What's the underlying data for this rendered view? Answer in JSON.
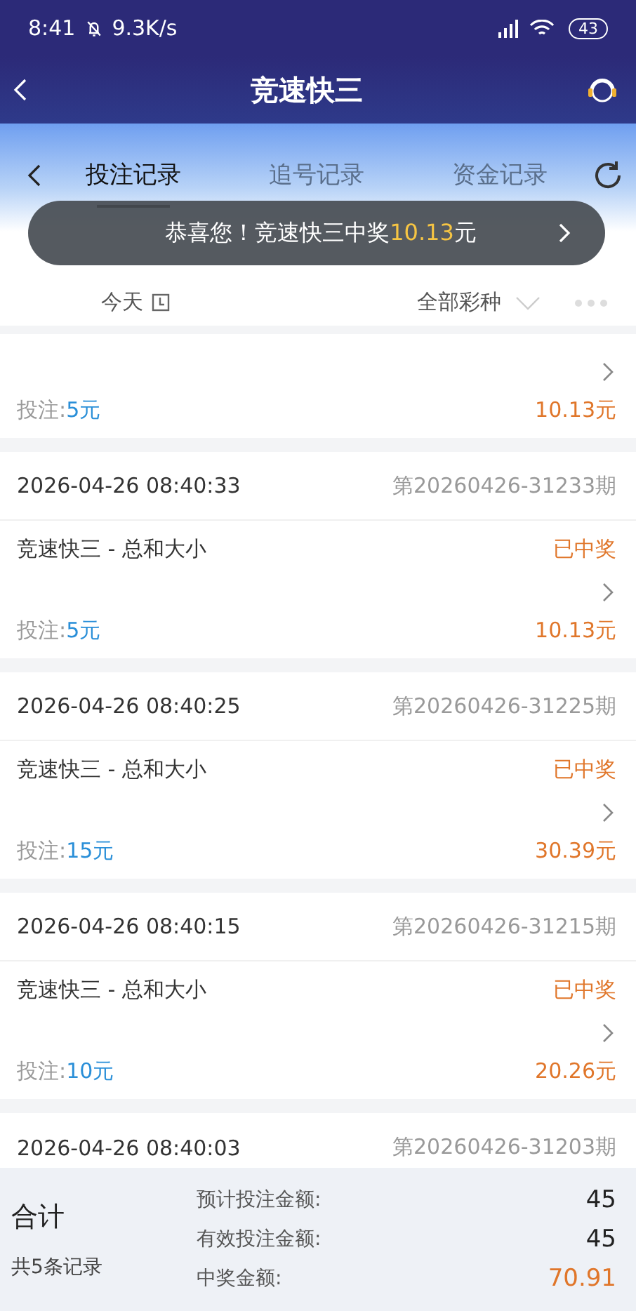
{
  "status_bar": {
    "time": "8:41",
    "speed": "9.3K/s",
    "battery": "43"
  },
  "header": {
    "title": "竞速快三"
  },
  "tabs": [
    {
      "label": "投注记录",
      "selected": true
    },
    {
      "label": "追号记录",
      "selected": false
    },
    {
      "label": "资金记录",
      "selected": false
    }
  ],
  "toast": {
    "message": "恭喜您！竞速快三中奖",
    "amount": "10.13",
    "unit": "元"
  },
  "filter": {
    "date": "今天",
    "lottery": "全部彩种"
  },
  "records": [
    {
      "kind": "partial",
      "bet_label": "投注:",
      "bet": "5元",
      "prize": "10.13元"
    },
    {
      "kind": "full",
      "time": "2026-04-26 08:40:33",
      "issue": "第20260426-31233期",
      "name": "竞速快三 - 总和大小",
      "status": "已中奖",
      "bet_label": "投注:",
      "bet": "5元",
      "prize": "10.13元"
    },
    {
      "kind": "full",
      "time": "2026-04-26 08:40:25",
      "issue": "第20260426-31225期",
      "name": "竞速快三 - 总和大小",
      "status": "已中奖",
      "bet_label": "投注:",
      "bet": "15元",
      "prize": "30.39元"
    },
    {
      "kind": "full",
      "time": "2026-04-26 08:40:15",
      "issue": "第20260426-31215期",
      "name": "竞速快三 - 总和大小",
      "status": "已中奖",
      "bet_label": "投注:",
      "bet": "10元",
      "prize": "20.26元"
    },
    {
      "kind": "head",
      "time": "2026-04-26 08:40:03",
      "issue": "第20260426-31203期"
    }
  ],
  "summary": {
    "title": "合计",
    "count": "共5条记录",
    "rows": [
      {
        "kind": "amount",
        "label": "预计投注金额:",
        "value": "45"
      },
      {
        "kind": "amount",
        "label": "有效投注金额:",
        "value": "45"
      },
      {
        "kind": "prize",
        "label": "中奖金额:",
        "value": "70.91"
      }
    ]
  }
}
